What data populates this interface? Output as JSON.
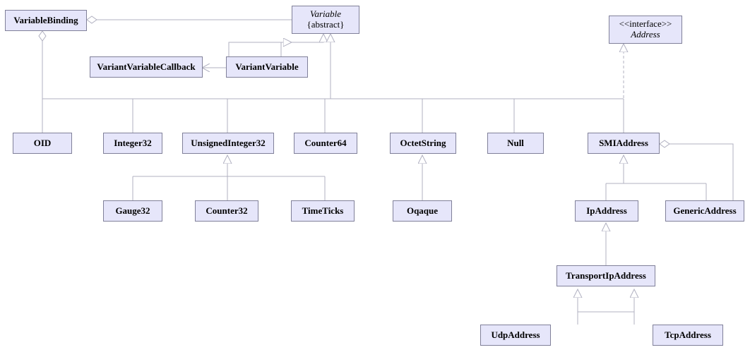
{
  "chart_data": {
    "type": "uml_class_diagram",
    "nodes": [
      {
        "id": "VariableBinding",
        "label": "VariableBinding"
      },
      {
        "id": "Variable",
        "label": "Variable",
        "stereotype": "{abstract}",
        "italic": true
      },
      {
        "id": "Address",
        "label": "Address",
        "stereotype": "<<interface>>",
        "italic": true
      },
      {
        "id": "VariantVariableCallback",
        "label": "VariantVariableCallback"
      },
      {
        "id": "VariantVariable",
        "label": "VariantVariable"
      },
      {
        "id": "OID",
        "label": "OID"
      },
      {
        "id": "Integer32",
        "label": "Integer32"
      },
      {
        "id": "UnsignedInteger32",
        "label": "UnsignedInteger32"
      },
      {
        "id": "Counter64",
        "label": "Counter64"
      },
      {
        "id": "OctetString",
        "label": "OctetString"
      },
      {
        "id": "Null",
        "label": "Null"
      },
      {
        "id": "SMIAddress",
        "label": "SMIAddress"
      },
      {
        "id": "Gauge32",
        "label": "Gauge32"
      },
      {
        "id": "Counter32",
        "label": "Counter32"
      },
      {
        "id": "TimeTicks",
        "label": "TimeTicks"
      },
      {
        "id": "Oqaque",
        "label": "Oqaque"
      },
      {
        "id": "IpAddress",
        "label": "IpAddress"
      },
      {
        "id": "GenericAddress",
        "label": "GenericAddress"
      },
      {
        "id": "TransportIpAddress",
        "label": "TransportIpAddress"
      },
      {
        "id": "UdpAddress",
        "label": "UdpAddress"
      },
      {
        "id": "TcpAddress",
        "label": "TcpAddress"
      }
    ],
    "edges": [
      {
        "from": "VariableBinding",
        "to": "Variable",
        "type": "aggregation"
      },
      {
        "from": "VariableBinding",
        "to": "OID",
        "type": "aggregation"
      },
      {
        "from": "VariantVariable",
        "to": "Variable",
        "type": "generalization"
      },
      {
        "from": "VariantVariable",
        "to": "VariantVariableCallback",
        "type": "dependency"
      },
      {
        "from": "OID",
        "to": "Variable",
        "type": "generalization"
      },
      {
        "from": "Integer32",
        "to": "Variable",
        "type": "generalization"
      },
      {
        "from": "UnsignedInteger32",
        "to": "Variable",
        "type": "generalization"
      },
      {
        "from": "Counter64",
        "to": "Variable",
        "type": "generalization"
      },
      {
        "from": "OctetString",
        "to": "Variable",
        "type": "generalization"
      },
      {
        "from": "Null",
        "to": "Variable",
        "type": "generalization"
      },
      {
        "from": "SMIAddress",
        "to": "Variable",
        "type": "generalization"
      },
      {
        "from": "SMIAddress",
        "to": "Address",
        "type": "realization"
      },
      {
        "from": "Gauge32",
        "to": "UnsignedInteger32",
        "type": "generalization"
      },
      {
        "from": "Counter32",
        "to": "UnsignedInteger32",
        "type": "generalization"
      },
      {
        "from": "TimeTicks",
        "to": "UnsignedInteger32",
        "type": "generalization"
      },
      {
        "from": "Oqaque",
        "to": "OctetString",
        "type": "generalization"
      },
      {
        "from": "IpAddress",
        "to": "SMIAddress",
        "type": "generalization"
      },
      {
        "from": "GenericAddress",
        "to": "SMIAddress",
        "type": "generalization"
      },
      {
        "from": "GenericAddress",
        "to": "SMIAddress",
        "type": "aggregation"
      },
      {
        "from": "TransportIpAddress",
        "to": "IpAddress",
        "type": "generalization"
      },
      {
        "from": "UdpAddress",
        "to": "TransportIpAddress",
        "type": "generalization"
      },
      {
        "from": "TcpAddress",
        "to": "TransportIpAddress",
        "type": "generalization"
      }
    ]
  },
  "boxes": {
    "VariableBinding": {
      "l": "VariableBinding"
    },
    "Variable": {
      "l": "Variable",
      "s": "{abstract}"
    },
    "Address": {
      "l": "Address",
      "s": "<<interface>>"
    },
    "VariantVariableCallback": {
      "l": "VariantVariableCallback"
    },
    "VariantVariable": {
      "l": "VariantVariable"
    },
    "OID": {
      "l": "OID"
    },
    "Integer32": {
      "l": "Integer32"
    },
    "UnsignedInteger32": {
      "l": "UnsignedInteger32"
    },
    "Counter64": {
      "l": "Counter64"
    },
    "OctetString": {
      "l": "OctetString"
    },
    "Null": {
      "l": "Null"
    },
    "SMIAddress": {
      "l": "SMIAddress"
    },
    "Gauge32": {
      "l": "Gauge32"
    },
    "Counter32": {
      "l": "Counter32"
    },
    "TimeTicks": {
      "l": "TimeTicks"
    },
    "Oqaque": {
      "l": "Oqaque"
    },
    "IpAddress": {
      "l": "IpAddress"
    },
    "GenericAddress": {
      "l": "GenericAddress"
    },
    "TransportIpAddress": {
      "l": "TransportIpAddress"
    },
    "UdpAddress": {
      "l": "UdpAddress"
    },
    "TcpAddress": {
      "l": "TcpAddress"
    }
  }
}
